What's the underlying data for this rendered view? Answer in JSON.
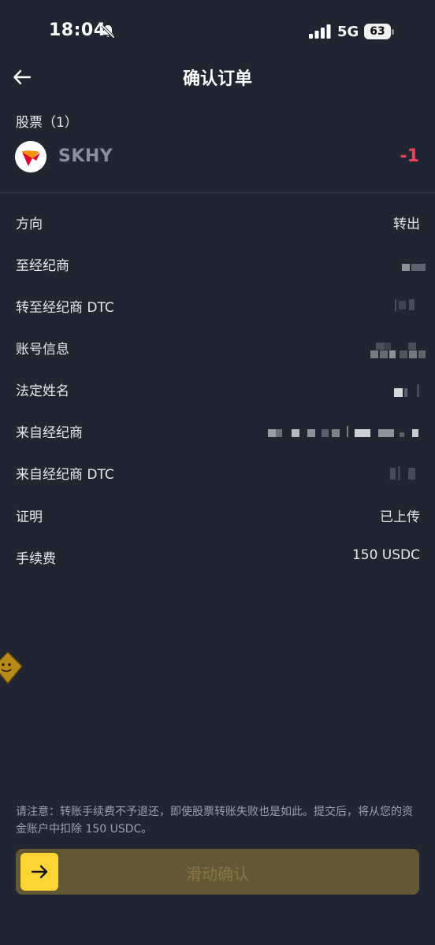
{
  "status_bar": {
    "time": "18:04",
    "network": "5G",
    "battery": "63"
  },
  "header": {
    "title": "确认订单"
  },
  "stocks_section": {
    "label": "股票（1）",
    "items": [
      {
        "symbol": "SKHY",
        "quantity": "-1"
      }
    ]
  },
  "details": [
    {
      "label": "方向",
      "value": "转出"
    },
    {
      "label": "至经纪商",
      "value": ""
    },
    {
      "label": "转至经纪商 DTC",
      "value": ""
    },
    {
      "label": "账号信息",
      "value": ""
    },
    {
      "label": "法定姓名",
      "value": ""
    },
    {
      "label": "来自经纪商",
      "value": ""
    },
    {
      "label": "来自经纪商 DTC",
      "value": ""
    },
    {
      "label": "证明",
      "value": "已上传"
    },
    {
      "label": "手续费",
      "value": "150 USDC"
    }
  ],
  "notice": "请注意：转账手续费不予退还，即使股票转账失败也是如此。提交后，将从您的资金账户中扣除 150 USDC。",
  "confirm_slider": {
    "label": "滑动确认"
  },
  "colors": {
    "background": "#212532",
    "negative": "#f0415a",
    "accent": "#fcd434",
    "slider_track": "#625834"
  }
}
